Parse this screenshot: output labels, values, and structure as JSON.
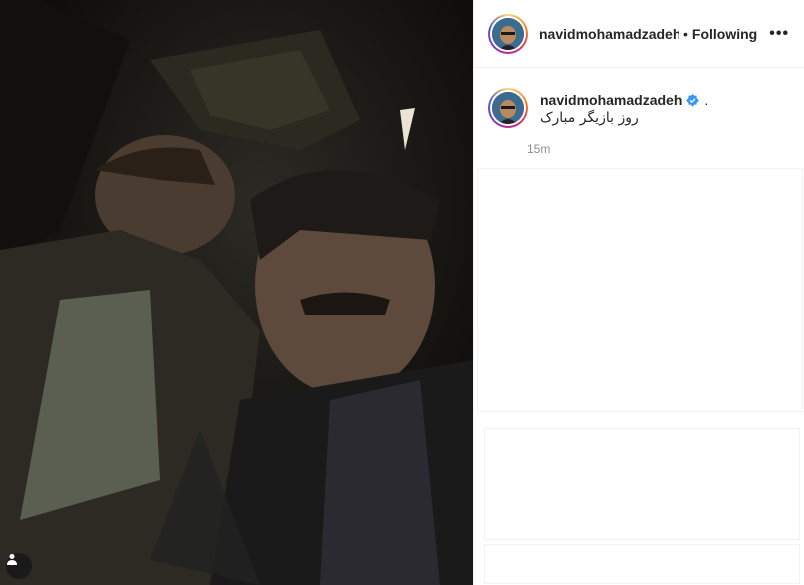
{
  "header": {
    "username": "navidmohamadzadeh",
    "separator": "•",
    "follow_status": "Following",
    "more_label": "•••"
  },
  "caption": {
    "username": "navidmohamadzadeh",
    "trailing": ".",
    "text": "روز بازیگر مبارک",
    "timestamp": "15m"
  },
  "icons": {
    "verified": "verified-badge-icon",
    "tag_user": "user-icon"
  },
  "colors": {
    "verified": "#3897f0",
    "photo_bg": "#0b0a09"
  }
}
